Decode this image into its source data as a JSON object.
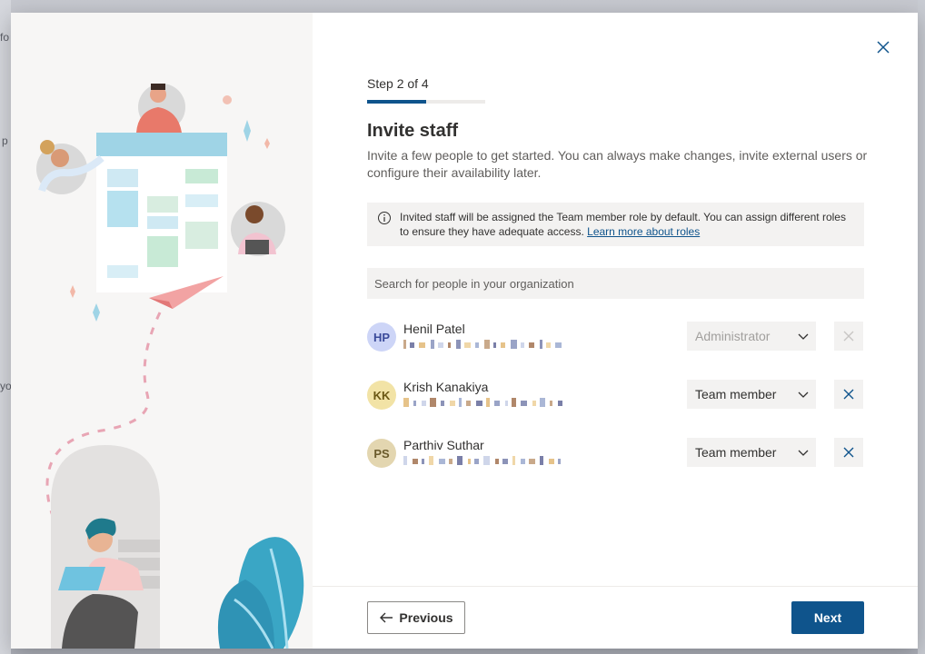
{
  "background": {
    "fragments": [
      "fo",
      "p",
      "yo"
    ]
  },
  "dialog": {
    "step_label": "Step 2 of 4",
    "progress": 0.5,
    "title": "Invite staff",
    "subtitle": "Invite a few people to get started. You can always make changes, invite external users or configure their availability later.",
    "info_text": "Invited staff will be assigned the Team member role by default. You can assign different roles to ensure they have adequate access.",
    "info_link": "Learn more about roles",
    "search_placeholder": "Search for people in your organization",
    "people": [
      {
        "initials": "HP",
        "name": "Henil Patel",
        "role": "Administrator",
        "role_disabled": true,
        "avatar_bg": "#cdd5f7",
        "avatar_fg": "#3a4a9a"
      },
      {
        "initials": "KK",
        "name": "Krish Kanakiya",
        "role": "Team member",
        "role_disabled": false,
        "avatar_bg": "#f2e3a6",
        "avatar_fg": "#6a5714"
      },
      {
        "initials": "PS",
        "name": "Parthiv Suthar",
        "role": "Team member",
        "role_disabled": false,
        "avatar_bg": "#e3d6b0",
        "avatar_fg": "#6a5a2a"
      }
    ],
    "footer": {
      "previous_label": "Previous",
      "next_label": "Next"
    }
  },
  "colors": {
    "accent": "#0f548c",
    "surface": "#f3f2f1"
  }
}
